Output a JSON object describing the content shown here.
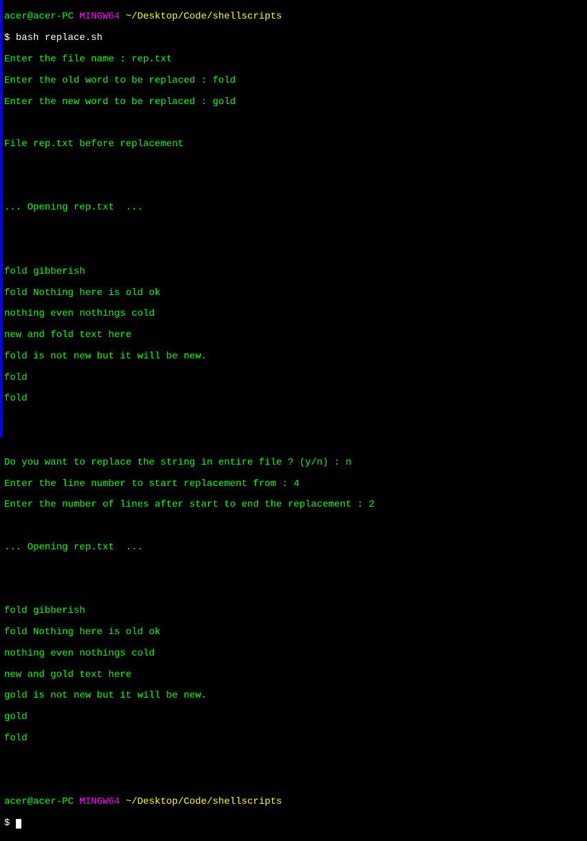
{
  "prompt1": {
    "user": "acer@acer-PC",
    "env": "MINGW64",
    "path": "~/Desktop/Code/shellscripts",
    "dollar": "$",
    "command": "bash replace.sh"
  },
  "lines": {
    "l1": "Enter the file name : rep.txt",
    "l2": "Enter the old word to be replaced : fold",
    "l3": "Enter the new word to be replaced : gold",
    "l4": "File rep.txt before replacement",
    "l5": "... Opening rep.txt  ...",
    "l6": "fold gibberish",
    "l7": "fold Nothing here is old ok",
    "l8": "nothing even nothings cold",
    "l9": "new and fold text here",
    "l10": "fold is not new but it will be new.",
    "l11": "fold",
    "l12": "fold",
    "l13": "Do you want to replace the string in entire file ? (y/n) : n",
    "l14": "Enter the line number to start replacement from : 4",
    "l15": "Enter the number of lines after start to end the replacement : 2",
    "l16": "... Opening rep.txt  ...",
    "l17": "fold gibberish",
    "l18": "fold Nothing here is old ok",
    "l19": "nothing even nothings cold",
    "l20": "new and gold text here",
    "l21": "gold is not new but it will be new.",
    "l22": "gold",
    "l23": "fold"
  },
  "prompt2": {
    "user": "acer@acer-PC",
    "env": "MINGW64",
    "path": "~/Desktop/Code/shellscripts",
    "dollar": "$"
  }
}
